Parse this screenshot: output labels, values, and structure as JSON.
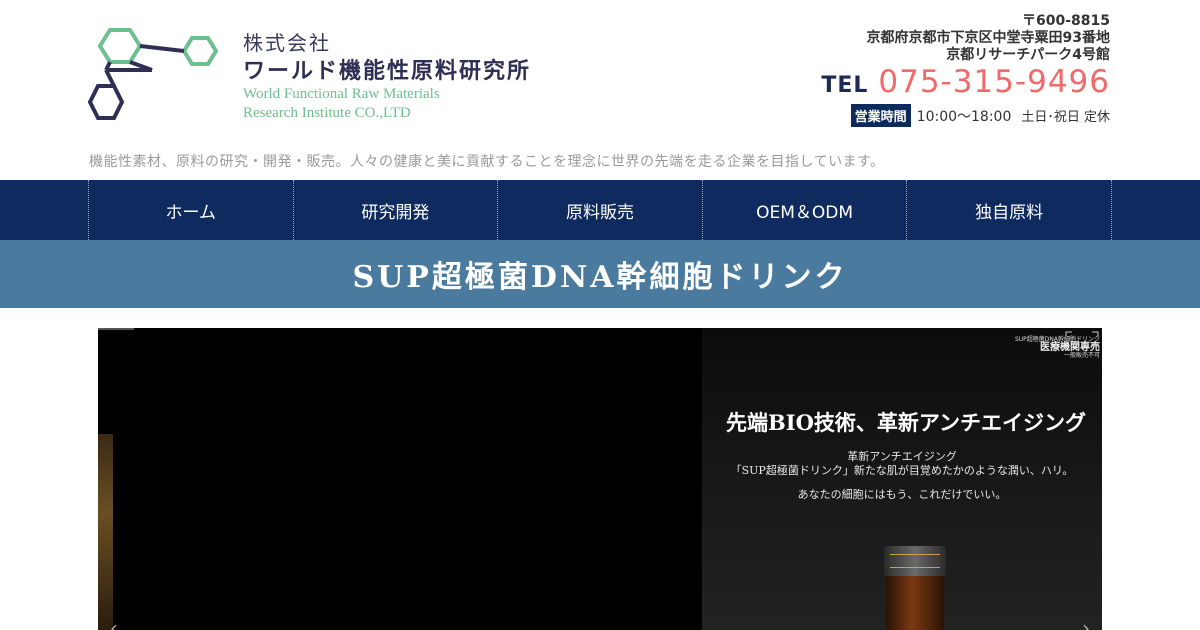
{
  "header": {
    "company_name_line1": "株式会社",
    "company_name_line2": "ワールド機能性原料研究所",
    "company_name_en_line1": "World Functional Raw Materials",
    "company_name_en_line2": "Research Institute CO.,LTD",
    "postal": "〒600-8815",
    "address_line1": "京都府京都市下京区中堂寺粟田93番地",
    "address_line2": "京都リサーチパーク4号館",
    "tel_label": "TEL",
    "tel_number": "075-315-9496",
    "hours_label": "営業時間",
    "hours_time": "10:00〜18:00",
    "hours_closed": "土日･祝日 定休",
    "tagline": "機能性素材、原料の研究・開発・販売。人々の健康と美に貢献することを理念に世界の先端を走る企業を目指しています。"
  },
  "nav": {
    "items": [
      "ホーム",
      "研究開発",
      "原料販売",
      "OEM＆ODM",
      "独自原料"
    ]
  },
  "page": {
    "title": "SUP超極菌DNA幹細胞ドリンク"
  },
  "hero": {
    "corner_text_small": "SUP超極菌DNA幹細胞ドリンク",
    "corner_text_big": "医療機関専売",
    "corner_text_sub": "一般販売不可",
    "headline": "先端BIO技術、革新アンチエイジング",
    "sub_line1": "革新アンチエイジング",
    "sub_line2": "「SUP超極菌ドリンク」新たな肌が目覚めたかのような潤い、ハリ。",
    "sub_line3": "あなたの細胞にはもう、これだけでいい。"
  },
  "colors": {
    "nav_bg": "#0f2a5f",
    "title_band_bg": "#4a7a9e",
    "tel_accent": "#f06a6a",
    "logo_green": "#6cbf8e",
    "logo_navy": "#2f2f55"
  }
}
